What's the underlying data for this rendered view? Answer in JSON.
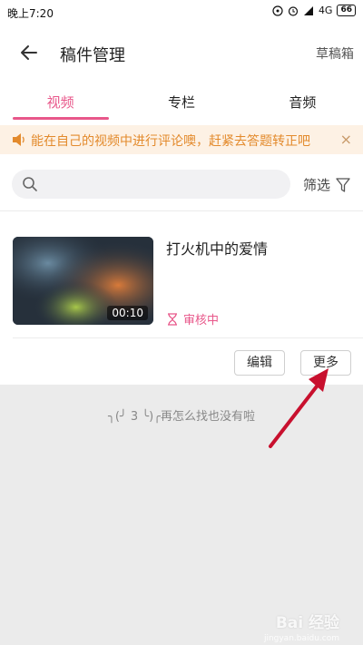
{
  "status_bar": {
    "time": "晚上7:20",
    "network": "4G",
    "battery": "66"
  },
  "app_bar": {
    "title": "稿件管理",
    "drafts_label": "草稿箱"
  },
  "tabs": [
    {
      "label": "视频",
      "active": true
    },
    {
      "label": "专栏",
      "active": false
    },
    {
      "label": "音频",
      "active": false
    }
  ],
  "notice": {
    "text": "能在自己的视频中进行评论噢，赶紧去答题转正吧",
    "close": "×"
  },
  "search": {
    "placeholder": "",
    "value": ""
  },
  "filter": {
    "label": "筛选"
  },
  "video": {
    "title": "打火机中的爱情",
    "duration": "00:10",
    "status": "审核中"
  },
  "actions": {
    "edit_label": "编辑",
    "more_label": "更多"
  },
  "empty": {
    "text": "╮(╯ 3 ╰)╭再怎么找也没有啦"
  },
  "watermark": {
    "brand": "Bai 经验",
    "sub": "jingyan.baidu.com"
  },
  "colors": {
    "accent": "#e8578a",
    "notice_text": "#e38a2c",
    "notice_bg": "#fdf1e4",
    "annotation_arrow": "#c8102e"
  }
}
